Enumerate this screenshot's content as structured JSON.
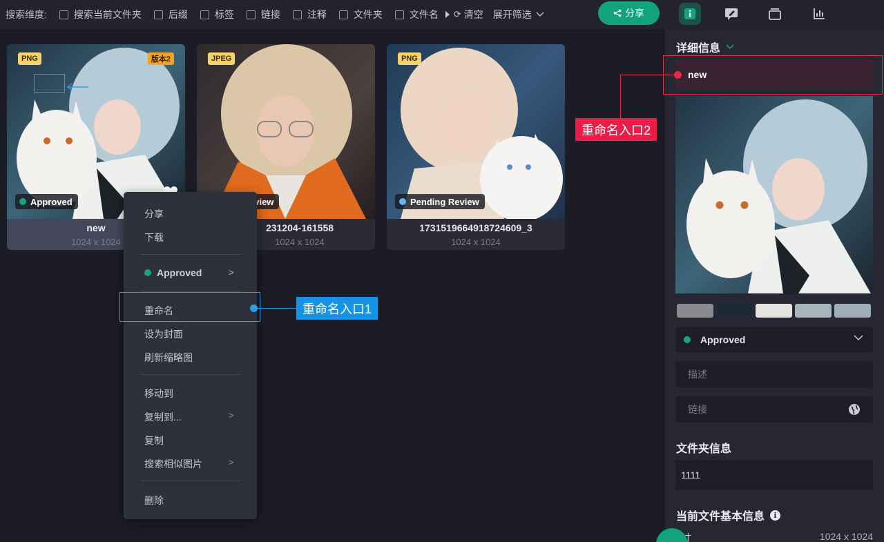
{
  "toolbar": {
    "search_dim_label": "搜索维度:",
    "checkboxes": [
      "搜索当前文件夹",
      "后缀",
      "标签",
      "链接",
      "注释",
      "文件夹",
      "文件名"
    ],
    "clear_label": "清空",
    "expand_filter_label": "展开筛选",
    "share_label": "分享"
  },
  "right_tabs": [
    "info-icon",
    "edit-icon",
    "layers-icon",
    "chart-icon"
  ],
  "cards": [
    {
      "type_badge": "PNG",
      "version_badge": "版本2",
      "status": "Approved",
      "status_color": "#16a37e",
      "name": "new",
      "dims": "1024 x 1024"
    },
    {
      "type_badge": "JPEG",
      "status": "eview",
      "status_color": "#16a37e",
      "name": "231204-161558",
      "dims": "1024 x 1024"
    },
    {
      "type_badge": "PNG",
      "status": "Pending Review",
      "status_color": "#5cb8f2",
      "name": "1731519664918724609_3",
      "dims": "1024 x 1024"
    }
  ],
  "context_menu": {
    "share": "分享",
    "download": "下载",
    "status": "Approved",
    "rename": "重命名",
    "set_cover": "设为封面",
    "refresh_thumb": "刷新缩略图",
    "move_to": "移动到",
    "copy_to": "复制到...",
    "copy": "复制",
    "search_similar": "搜索相似图片",
    "delete": "删除"
  },
  "annotations": {
    "entry1": "重命名入口1",
    "entry2": "重命名入口2"
  },
  "panel": {
    "details_title": "详细信息",
    "name_value": "new",
    "swatches": [
      "#8a8b8e",
      "#1b2a36",
      "#e6e3df",
      "#a7b4bb",
      "#9eadb9"
    ],
    "status": "Approved",
    "desc_placeholder": "描述",
    "link_placeholder": "链接",
    "folder_title": "文件夹信息",
    "folder_value": "1111",
    "basic_title": "当前文件基本信息",
    "size_label": "寸",
    "size_value": "1024 x 1024"
  }
}
